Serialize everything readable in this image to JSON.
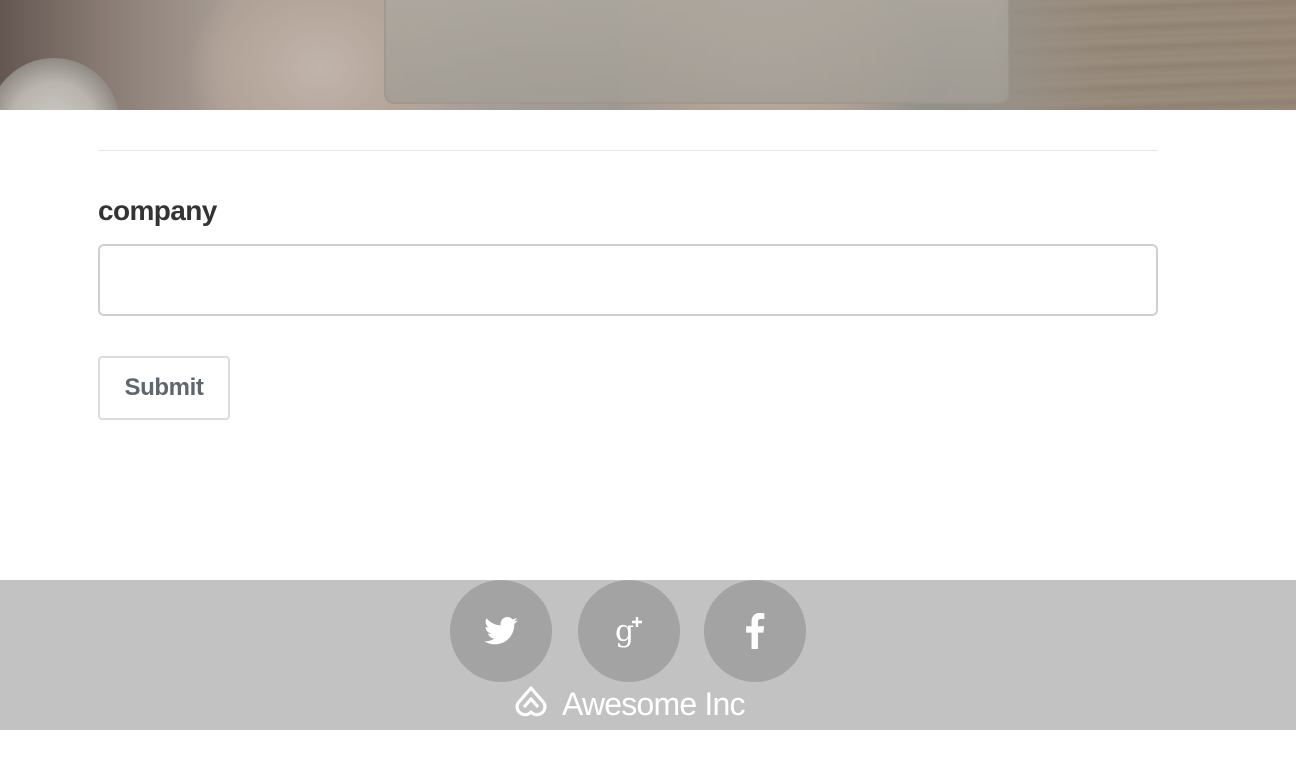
{
  "hero": {
    "image_icon": "desk-photo"
  },
  "form": {
    "field_label": "company",
    "field_value": "",
    "field_placeholder": "",
    "submit_label": "Submit"
  },
  "footer": {
    "social": [
      {
        "name": "twitter",
        "icon": "twitter-icon"
      },
      {
        "name": "google-plus",
        "icon": "google-plus-icon"
      },
      {
        "name": "facebook",
        "icon": "facebook-icon"
      }
    ],
    "brand_name": "Awesome Inc",
    "brand_icon": "logo-icon"
  },
  "colors": {
    "footer_bg": "#c2c2c2",
    "social_bg": "#a3a3a3",
    "label_text": "#333333",
    "button_text": "#5f6670",
    "input_border": "#cfcfcf"
  }
}
